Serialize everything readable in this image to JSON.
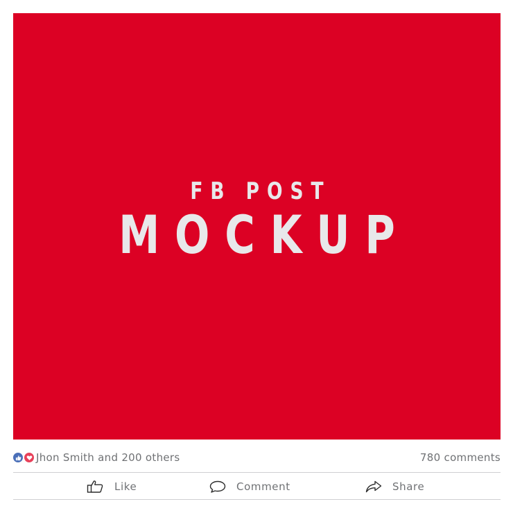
{
  "post": {
    "image": {
      "background_color": "#dc0124",
      "text_color": "#e8e8ea",
      "headline_small": "FB POST",
      "headline_big": "MOCKUP"
    },
    "reactions": {
      "icons": [
        "thumbs-up-icon",
        "heart-icon"
      ],
      "like_color": "#4a6fb8",
      "love_color": "#e8415a",
      "text": "Jhon Smith and 200 others"
    },
    "comments_count": "780 comments",
    "actions": {
      "like": {
        "label": "Like",
        "icon": "thumbs-up-outline-icon"
      },
      "comment": {
        "label": "Comment",
        "icon": "speech-bubble-icon"
      },
      "share": {
        "label": "Share",
        "icon": "share-arrow-icon"
      }
    }
  }
}
